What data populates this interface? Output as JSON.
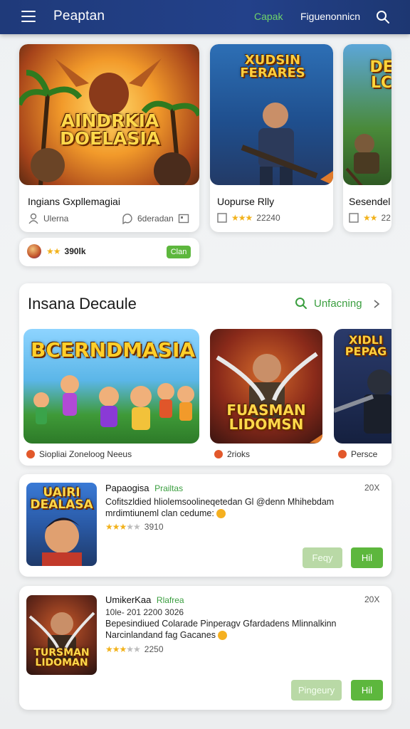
{
  "header": {
    "title": "Peaptan",
    "nav_active": "Capak",
    "nav_other": "Figuenonnicn"
  },
  "top_row": [
    {
      "art_text": "AINDRKIA DOELASIA",
      "title": "Ingians Gxpllemagiai",
      "meta_left": "Ulerna",
      "meta_right": "6deradan"
    },
    {
      "art_text": "XUDSIN FERARES",
      "title": "Uopurse Rlly",
      "rating": "22240"
    },
    {
      "art_text": "DE LC",
      "title": "Sesendel",
      "rating": "22"
    }
  ],
  "mini_card": {
    "rating": "390lk",
    "button": "Clan"
  },
  "section": {
    "title": "Insana Decaule",
    "link": "Unfacning",
    "items": [
      {
        "art_text": "BCERNDMASIA",
        "label": "Siopliai Zoneloog Neeus"
      },
      {
        "art_text": "FUASMAN LIDOMSN",
        "label": "2rioks"
      },
      {
        "art_text": "XIDLI PEPAG",
        "label": "Persce"
      }
    ]
  },
  "list": [
    {
      "art_text": "UAIRI DEALASA",
      "title": "Papaogisa",
      "tag": "Prailtas",
      "line1": "Cofitszldied hliolemsoolineqetedan Gl @denn Mhihebdam",
      "line2": "mrdimtiuneml clan cedume:",
      "rating": "3910",
      "count": "20X",
      "btn1": "Feqy",
      "btn2": "Hil"
    },
    {
      "art_text": "TURSMAN LIDOMAN",
      "title": "UmikerKaa",
      "tag": "Rlafrea",
      "line0": "10le- 201 2200 3026",
      "line1": "Bepesindiued Colarade Pinperagv Gfardadens Mlinnalkinn",
      "line2": "Narcinlandand fag Gacanes",
      "rating": "2250",
      "count": "20X",
      "btn1": "Pingeury",
      "btn2": "Hil"
    }
  ],
  "colors": {
    "header": "#1f3a7a",
    "accent_green": "#5db73d",
    "star": "#f2b21b"
  }
}
